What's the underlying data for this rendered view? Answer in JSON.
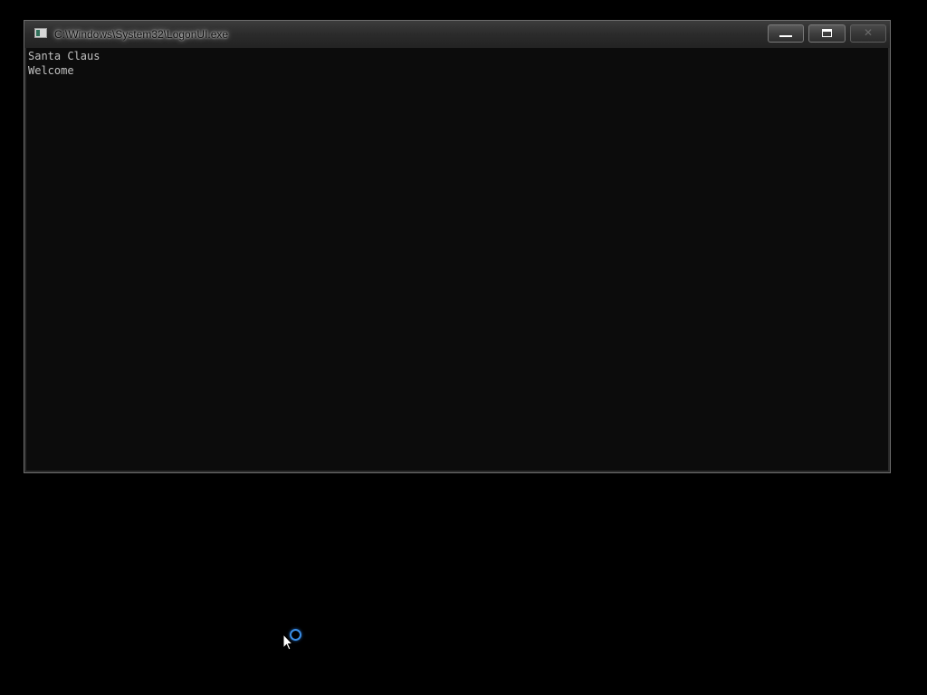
{
  "window": {
    "title": "C:\\Windows\\System32\\LogonUI.exe",
    "icon": "console-app-icon",
    "controls": {
      "minimize": "minimize",
      "maximize": "maximize",
      "close": "close"
    }
  },
  "console": {
    "lines": [
      "Santa Claus",
      "Welcome"
    ]
  },
  "pointer": {
    "state": "busy",
    "accent_color": "#3a8ee6"
  }
}
